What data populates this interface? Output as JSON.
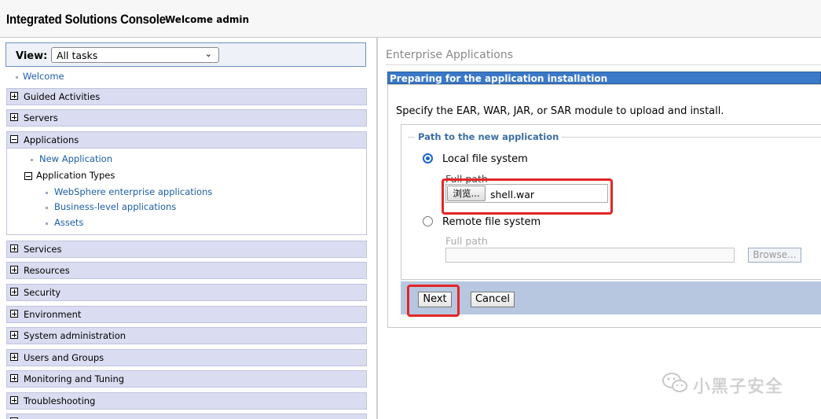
{
  "header": {
    "title": "Integrated Solutions Console",
    "welcome": "Welcome admin"
  },
  "nav": {
    "view_label": "View:",
    "view_select": "All tasks",
    "welcome_link": "Welcome",
    "categories": [
      "Guided Activities",
      "Servers",
      "Applications",
      "Services",
      "Resources",
      "Security",
      "Environment",
      "System administration",
      "Users and Groups",
      "Monitoring and Tuning",
      "Troubleshooting"
    ],
    "applications": {
      "new_application": "New Application",
      "application_types": "Application Types",
      "types": [
        "WebSphere enterprise applications",
        "Business-level applications",
        "Assets"
      ]
    }
  },
  "content": {
    "breadcrumb": "Enterprise Applications",
    "section_title": "Preparing for the application installation",
    "instruction": "Specify the EAR, WAR, JAR, or SAR module to upload and install.",
    "fieldset_legend": "Path to the new application",
    "local": {
      "label": "Local file system",
      "full_path_label": "Full path",
      "browse_label": "浏览...",
      "file_value": "shell.war"
    },
    "remote": {
      "label": "Remote file system",
      "full_path_label": "Full path",
      "browse_label": "Browse..."
    },
    "next_label": "Next",
    "cancel_label": "Cancel"
  },
  "watermark": {
    "text": "小黑子安全"
  },
  "colors": {
    "accent": "#3a78c8",
    "highlight": "#e32626",
    "nav_category": "#dadcf1",
    "button_bar": "#b7c7e0"
  }
}
